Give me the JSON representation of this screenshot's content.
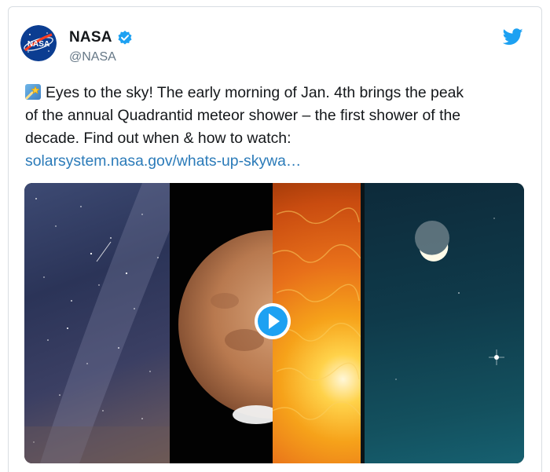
{
  "tweet": {
    "author_name": "NASA",
    "author_handle": "@NASA",
    "avatar_icon": "nasa-logo-icon",
    "verified_icon": "verified-badge-icon",
    "platform_icon": "twitter-bird-icon",
    "emoji_icon": "shooting-star-emoji-icon",
    "text_line1": "Eyes to the sky! The early morning of Jan. 4th brings the peak",
    "text_line2": "of the annual Quadrantid meteor shower – the first shower of the",
    "text_line3": "decade. Find out when & how to watch:",
    "link_text": "solarsystem.nasa.gov/whats-up-skywa…",
    "media": {
      "play_icon": "play-button-icon"
    }
  },
  "colors": {
    "link": "#2b7bb9",
    "twitter_blue": "#1da1f2",
    "handle_gray": "#657786"
  }
}
